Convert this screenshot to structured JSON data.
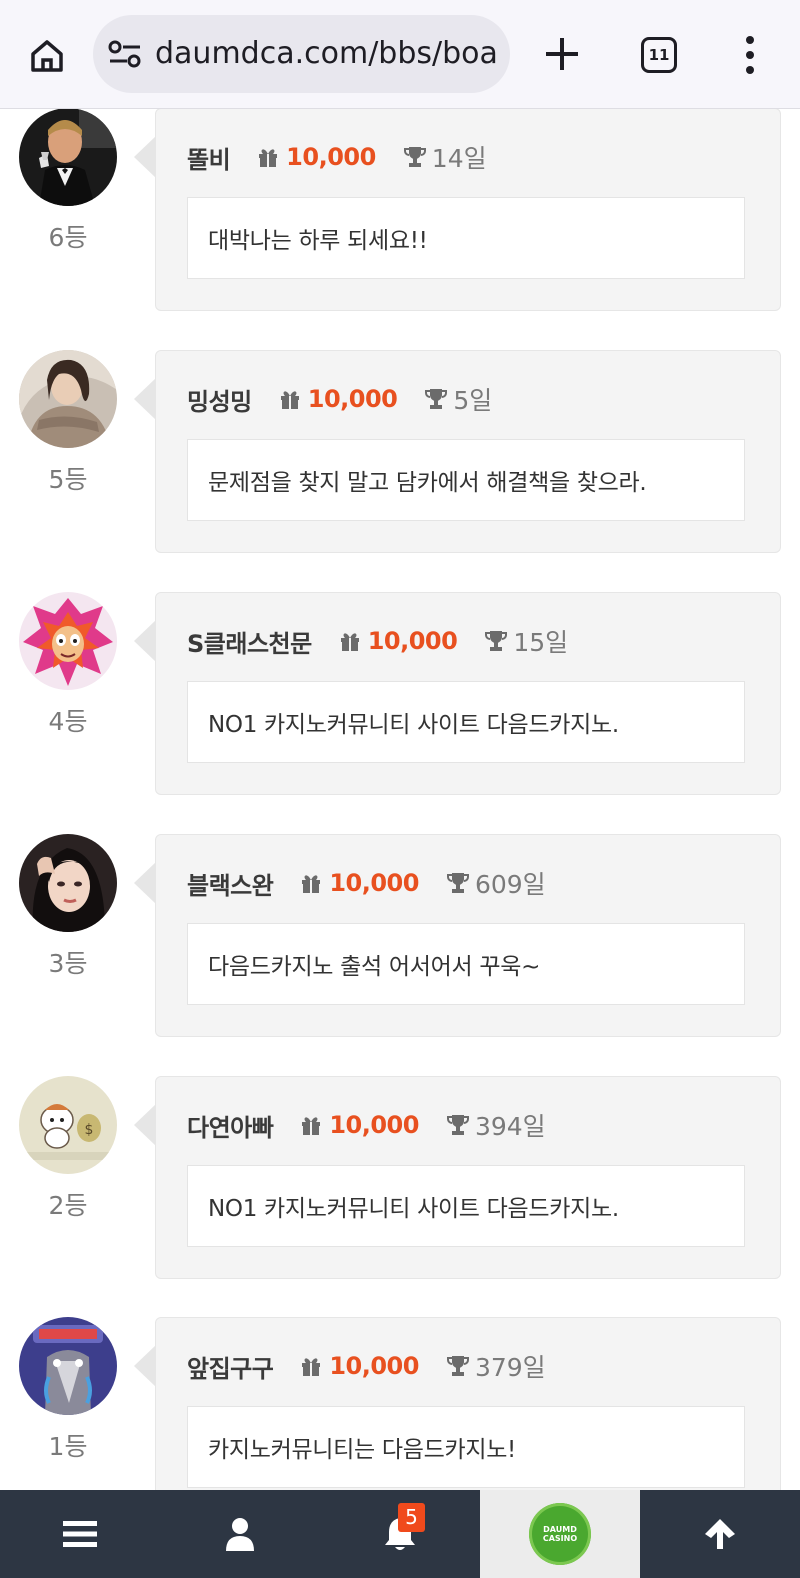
{
  "browser": {
    "url": "daumdca.com/bbs/board",
    "tab_count": "11"
  },
  "entries": [
    {
      "username": "똘비",
      "points": "10,000",
      "days": "14일",
      "message": "대박나는 하루 되세요!!",
      "rank": "6등"
    },
    {
      "username": "밍성밍",
      "points": "10,000",
      "days": "5일",
      "message": "문제점을 찾지 말고 담카에서 해결책을 찾으라.",
      "rank": "5등"
    },
    {
      "username": "S클래스천문",
      "points": "10,000",
      "days": "15일",
      "message": "NO1 카지노커뮤니티 사이트 다음드카지노.",
      "rank": "4등"
    },
    {
      "username": "블랙스완",
      "points": "10,000",
      "days": "609일",
      "message": "다음드카지노 출석 어서어서 꾸욱~",
      "rank": "3등"
    },
    {
      "username": "다연아빠",
      "points": "10,000",
      "days": "394일",
      "message": "NO1 카지노커뮤니티 사이트 다음드카지노.",
      "rank": "2등"
    },
    {
      "username": "앞집구구",
      "points": "10,000",
      "days": "379일",
      "message": "카지노커뮤니티는 다음드카지노!",
      "rank": "1등"
    }
  ],
  "bottom_nav": {
    "notification_count": "5",
    "logo_line1": "DAUMD",
    "logo_line2": "CASINO"
  },
  "icons": [
    "home-icon",
    "site-settings-icon",
    "new-tab-icon",
    "tab-switcher-icon",
    "more-menu-icon",
    "gift-icon",
    "trophy-icon",
    "hamburger-menu-icon",
    "user-icon",
    "bell-icon",
    "arrow-up-icon"
  ],
  "colors": {
    "points": "#e8501f",
    "nav_bg": "#2d3643",
    "badge": "#f04a1c"
  }
}
